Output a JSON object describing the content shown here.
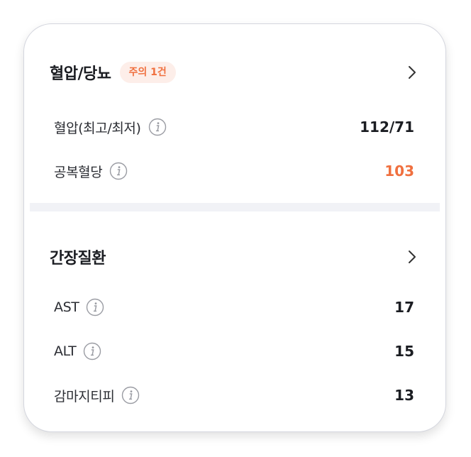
{
  "bp_section": {
    "title": "혈압/당뇨",
    "badge": "주의 1건",
    "rows": [
      {
        "label": "혈압(최고/최저)",
        "value": "112/71",
        "status": "normal"
      },
      {
        "label": "공복혈당",
        "value": "103",
        "status": "warning"
      }
    ]
  },
  "liver_section": {
    "title": "간장질환",
    "rows": [
      {
        "label": "AST",
        "value": "17",
        "status": "normal"
      },
      {
        "label": "ALT",
        "value": "15",
        "status": "normal"
      },
      {
        "label": "감마지티피",
        "value": "13",
        "status": "normal"
      }
    ]
  },
  "icons": {
    "chevron": "chevron-right-icon",
    "info": "info-icon"
  },
  "colors": {
    "warning": "#f0703f",
    "badge_bg": "#fdeee9",
    "text": "#1b1d22",
    "divider": "#f1f2f6"
  }
}
